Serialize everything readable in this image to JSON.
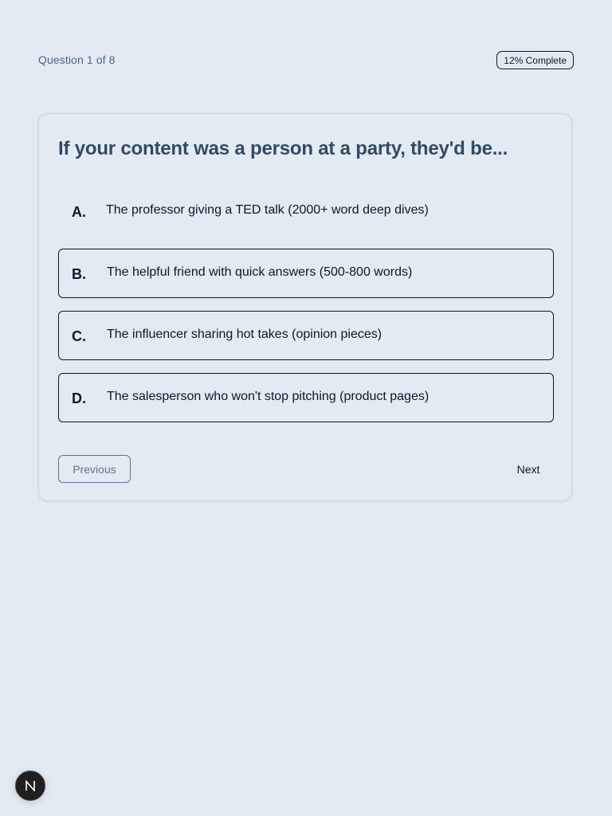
{
  "header": {
    "question_counter": "Question 1 of 8",
    "progress_label": "12% Complete",
    "progress_value": 0.12
  },
  "question": {
    "title": "If your content was a person at a party, they'd be...",
    "options": [
      {
        "letter": "A.",
        "text": "The professor giving a TED talk (2000+ word deep dives)",
        "selected": true
      },
      {
        "letter": "B.",
        "text": "The helpful friend with quick answers (500-800 words)",
        "selected": false
      },
      {
        "letter": "C.",
        "text": "The influencer sharing hot takes (opinion pieces)",
        "selected": false
      },
      {
        "letter": "D.",
        "text": "The salesperson who won't stop pitching (product pages)",
        "selected": false
      }
    ]
  },
  "navigation": {
    "previous_label": "Previous",
    "previous_disabled": true,
    "next_label": "Next"
  },
  "dev_indicator": {
    "icon": "n-logo-icon"
  },
  "colors": {
    "background": "#e3eaf2",
    "title": "#334a62",
    "counter": "#4b6683",
    "text": "#0f172a",
    "muted": "#64748b"
  }
}
